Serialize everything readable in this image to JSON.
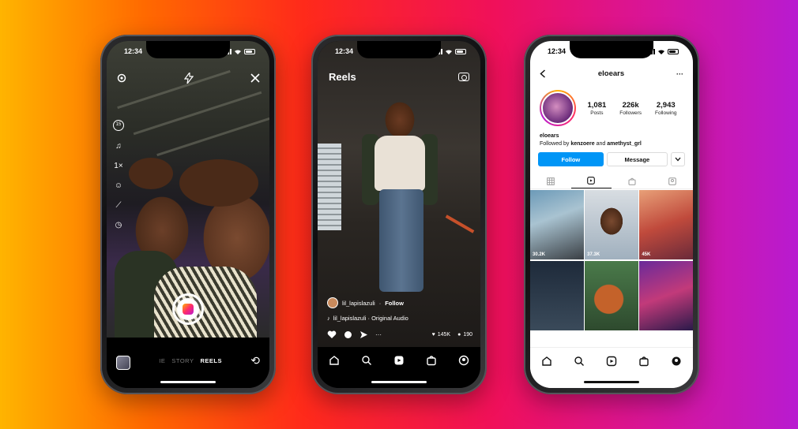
{
  "status": {
    "time": "12:34"
  },
  "camera": {
    "tools": {
      "speed": "1×",
      "timer": "15"
    },
    "modes": {
      "prev": "IE",
      "story": "STORY",
      "reels": "REELS"
    }
  },
  "reels": {
    "title": "Reels",
    "username": "lil_lapislazuli",
    "follow": "Follow",
    "audio": "lil_lapislazuli · Original Audio",
    "likes": "145K",
    "comments": "190",
    "more": "···"
  },
  "profile": {
    "username": "eloears",
    "posts": {
      "value": "1,081",
      "label": "Posts"
    },
    "followers": {
      "value": "226k",
      "label": "Followers"
    },
    "following": {
      "value": "2,943",
      "label": "Following"
    },
    "bio_name": "eloears",
    "followed_by_prefix": "Followed by",
    "followed_by_1": "kenzoere",
    "followed_by_and": "and",
    "followed_by_2": "amethyst_grl",
    "follow_button": "Follow",
    "message_button": "Message",
    "grid_views": [
      "30.2K",
      "37.3K",
      "45K"
    ]
  },
  "colors": {
    "follow_blue": "#0095f6"
  }
}
